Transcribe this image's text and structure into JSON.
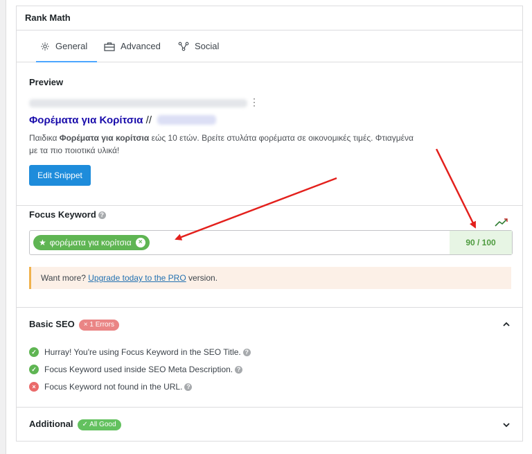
{
  "panel": {
    "title": "Rank Math"
  },
  "tabs": [
    {
      "label": "General",
      "icon": "gear-icon",
      "active": true
    },
    {
      "label": "Advanced",
      "icon": "toolbox-icon",
      "active": false
    },
    {
      "label": "Social",
      "icon": "share-nodes-icon",
      "active": false
    }
  ],
  "preview": {
    "label": "Preview",
    "title_main": "Φορέματα για Κορίτσια",
    "title_sep": " //",
    "desc_pre": "Παιδικα ",
    "desc_bold": "Φορέματα για κορίτσια",
    "desc_post": " εώς 10 ετών. Βρείτε στυλάτα φορέματα σε οικονομικές τιμές. Φτιαγμένα με τα πιο ποιοτικά υλικά!",
    "edit_button": "Edit Snippet"
  },
  "focus_keyword": {
    "label": "Focus Keyword",
    "keyword": "φορέματα για κορίτσια",
    "score": "90 / 100"
  },
  "upgrade": {
    "prefix": "Want more? ",
    "link": "Upgrade today to the PRO",
    "suffix": " version."
  },
  "basic_seo": {
    "label": "Basic SEO",
    "badge": "1 Errors",
    "items": [
      {
        "text": "Hurray! You're using Focus Keyword in the SEO Title.",
        "status": "pass"
      },
      {
        "text": "Focus Keyword used inside SEO Meta Description.",
        "status": "pass"
      },
      {
        "text": "Focus Keyword not found in the URL.",
        "status": "fail"
      }
    ]
  },
  "additional": {
    "label": "Additional",
    "badge": "All Good"
  },
  "colors": {
    "accent": "#4ca6ff",
    "good": "#5fb553",
    "error": "#ea8585",
    "button": "#1e8cdb",
    "arrow": "#e3201c"
  }
}
